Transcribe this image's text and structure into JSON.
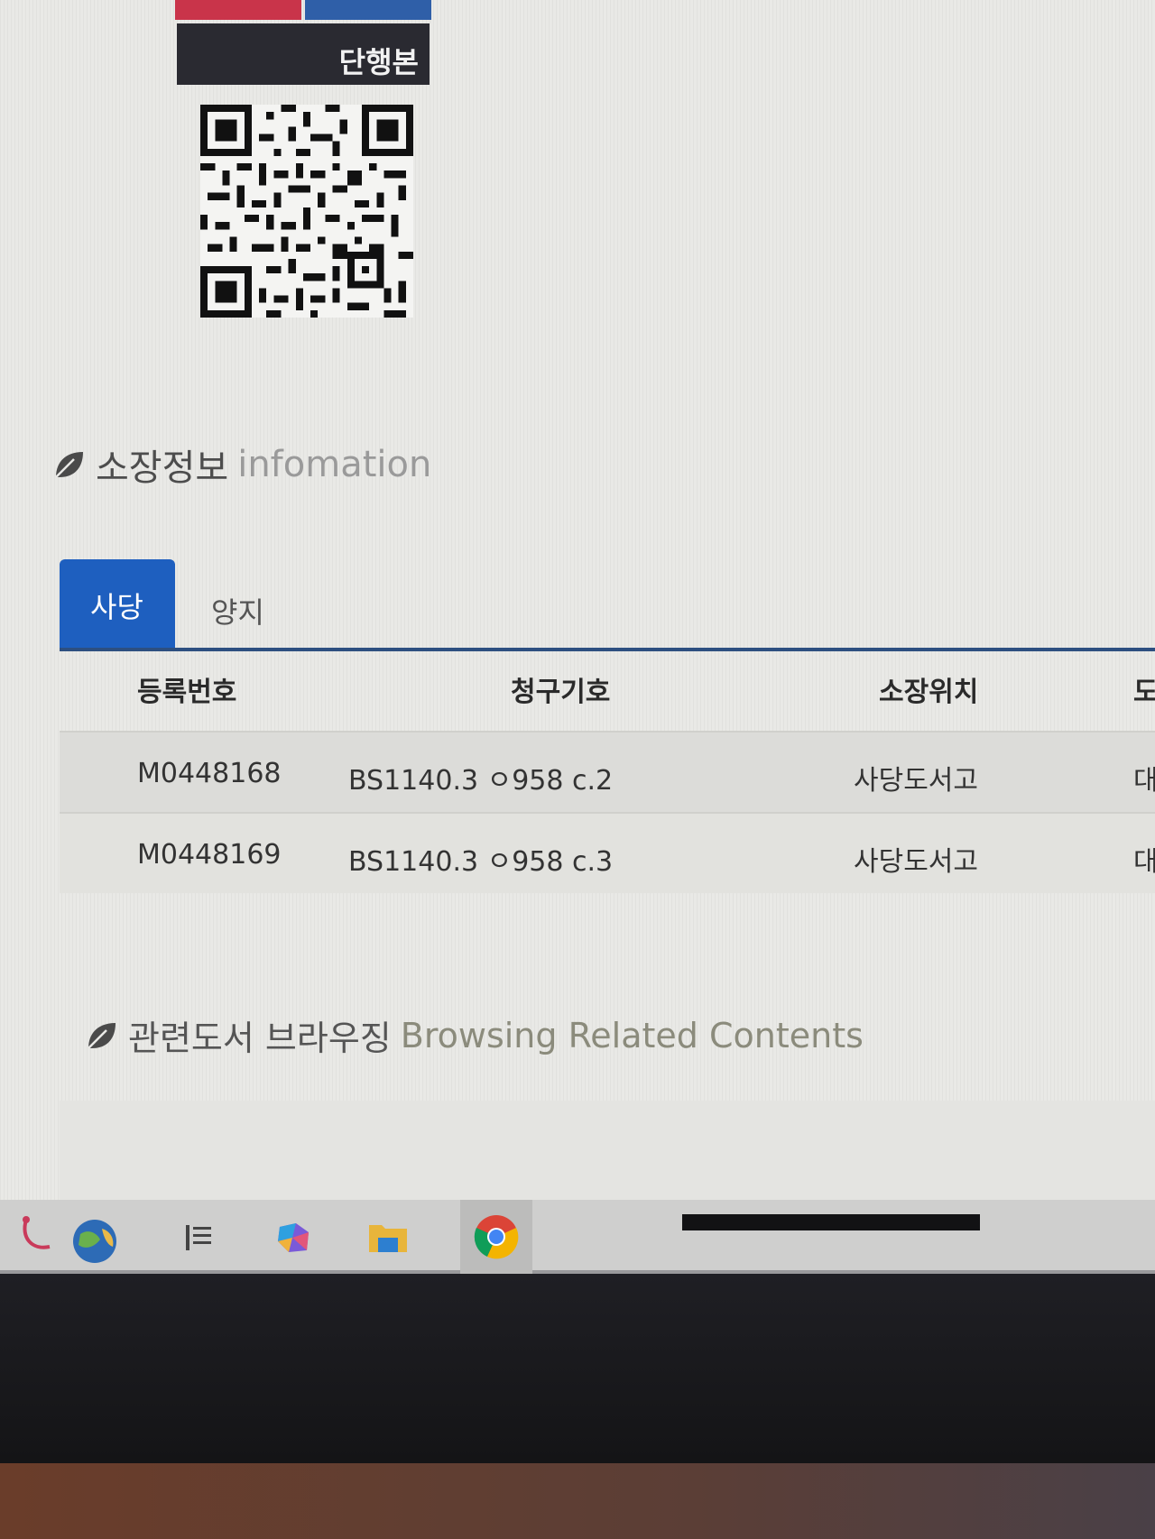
{
  "book": {
    "type_label": "단행본"
  },
  "holdings": {
    "title_ko": "소장정보",
    "title_en": "infomation",
    "tabs": [
      {
        "label": "사당",
        "active": true
      },
      {
        "label": "양지",
        "active": false
      }
    ],
    "columns": [
      "등록번호",
      "청구기호",
      "소장위치",
      "도"
    ],
    "rows": [
      {
        "reg_no": "M0448168",
        "call_no": "BS1140.3 ㅇ958 c.2",
        "location": "사당도서고",
        "status": "대"
      },
      {
        "reg_no": "M0448169",
        "call_no": "BS1140.3 ㅇ958 c.3",
        "location": "사당도서고",
        "status": "대출"
      }
    ]
  },
  "related": {
    "title_ko": "관련도서 브라우징",
    "title_en": "Browsing Related Contents"
  },
  "taskbar": {
    "icons": [
      "health-app-icon",
      "widgets-icon",
      "copilot-icon",
      "file-explorer-icon",
      "chrome-icon"
    ]
  },
  "colors": {
    "tab_active": "#1e5fbf",
    "tab_line": "#2d4f80",
    "badge_red": "#c9344a",
    "badge_blue": "#2f5fa8"
  }
}
